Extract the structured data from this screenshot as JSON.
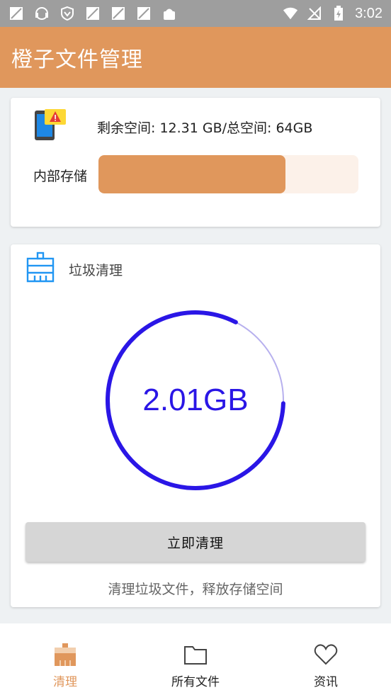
{
  "status_bar": {
    "time": "3:02",
    "notification_icons": [
      "silent-icon",
      "headset-icon",
      "shield-icon",
      "silent-icon",
      "silent-icon",
      "silent-icon",
      "android-icon"
    ],
    "system_icons": [
      "wifi-icon",
      "no-signal-icon",
      "battery-charging-icon"
    ]
  },
  "app_bar": {
    "title": "橙子文件管理"
  },
  "storage": {
    "space_text": "剩余空间: 12.31 GB/总空间: 64GB",
    "label": "内部存储",
    "used_fraction": 0.72
  },
  "clean": {
    "title": "垃圾清理",
    "value": "2.01GB",
    "ring_fraction": 0.82,
    "button_label": "立即清理",
    "hint": "清理垃圾文件，释放存储空间"
  },
  "nav": {
    "items": [
      {
        "label": "清理",
        "icon": "broom-icon",
        "active": true
      },
      {
        "label": "所有文件",
        "icon": "folder-icon",
        "active": false
      },
      {
        "label": "资讯",
        "icon": "heart-icon",
        "active": false
      }
    ]
  },
  "colors": {
    "accent": "#e0975c",
    "ring": "#2a16e6",
    "ring_track": "#b7b0ee",
    "blue_icon": "#2196f3"
  }
}
